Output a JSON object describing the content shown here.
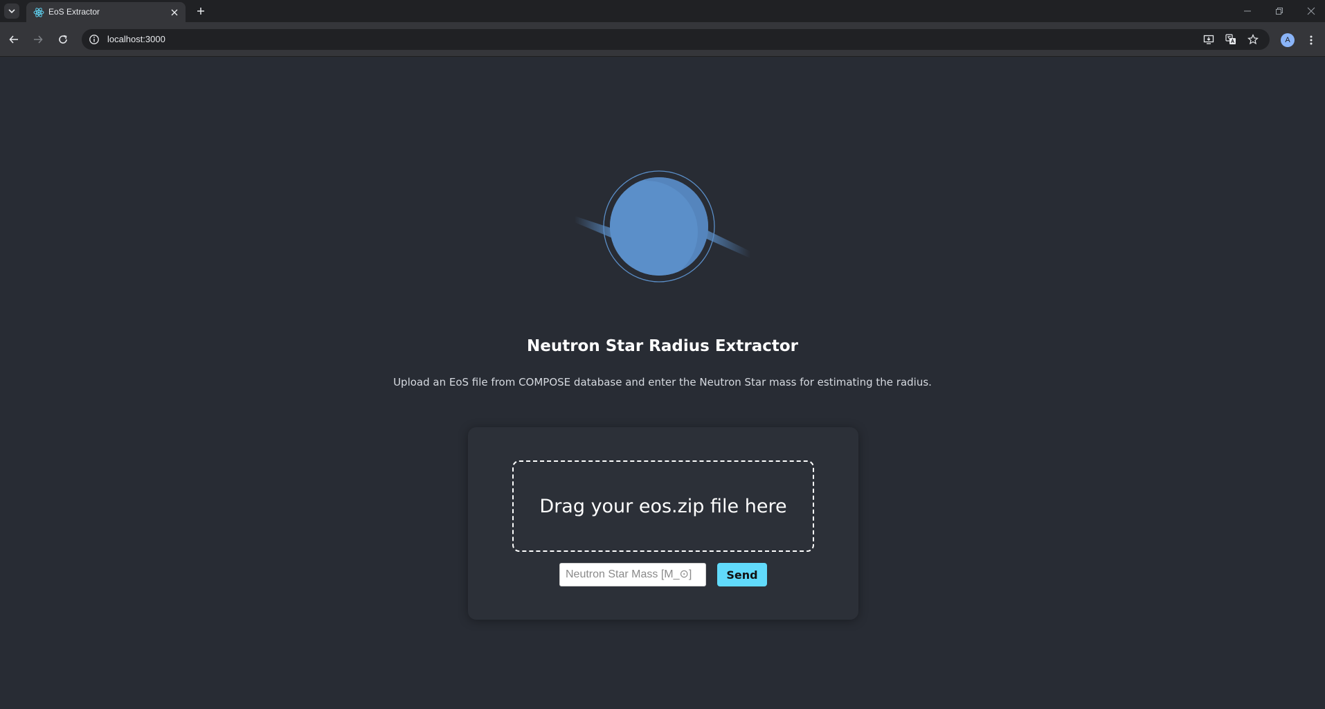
{
  "browser": {
    "tab_title": "EoS Extractor",
    "url": "localhost:3000",
    "profile_initial": "A",
    "icons": {
      "tab_list": "chevron-down-icon",
      "tab_favicon": "react-logo-icon",
      "tab_close": "close-icon",
      "new_tab": "plus-icon",
      "back": "arrow-left-icon",
      "forward": "arrow-right-icon",
      "reload": "reload-icon",
      "site_info": "info-icon",
      "install": "install-app-icon",
      "translate": "translate-icon",
      "bookmark": "star-icon",
      "menu": "kebab-menu-icon",
      "minimize": "minimize-icon",
      "restore": "restore-icon",
      "close_window": "close-icon"
    }
  },
  "page": {
    "title": "Neutron Star Radius Extractor",
    "subtitle": "Upload an EoS file from COMPOSE database and enter the Neutron Star mass for estimating the radius.",
    "dropzone_label": "Drag your eos.zip file here",
    "mass_input": {
      "value": "",
      "placeholder": "Neutron Star Mass [M_⊙]"
    },
    "send_label": "Send"
  },
  "colors": {
    "page_background": "#282c34",
    "card_background": "#2c3038",
    "accent": "#61dafb",
    "logo_blue": "#5b8fc9"
  }
}
